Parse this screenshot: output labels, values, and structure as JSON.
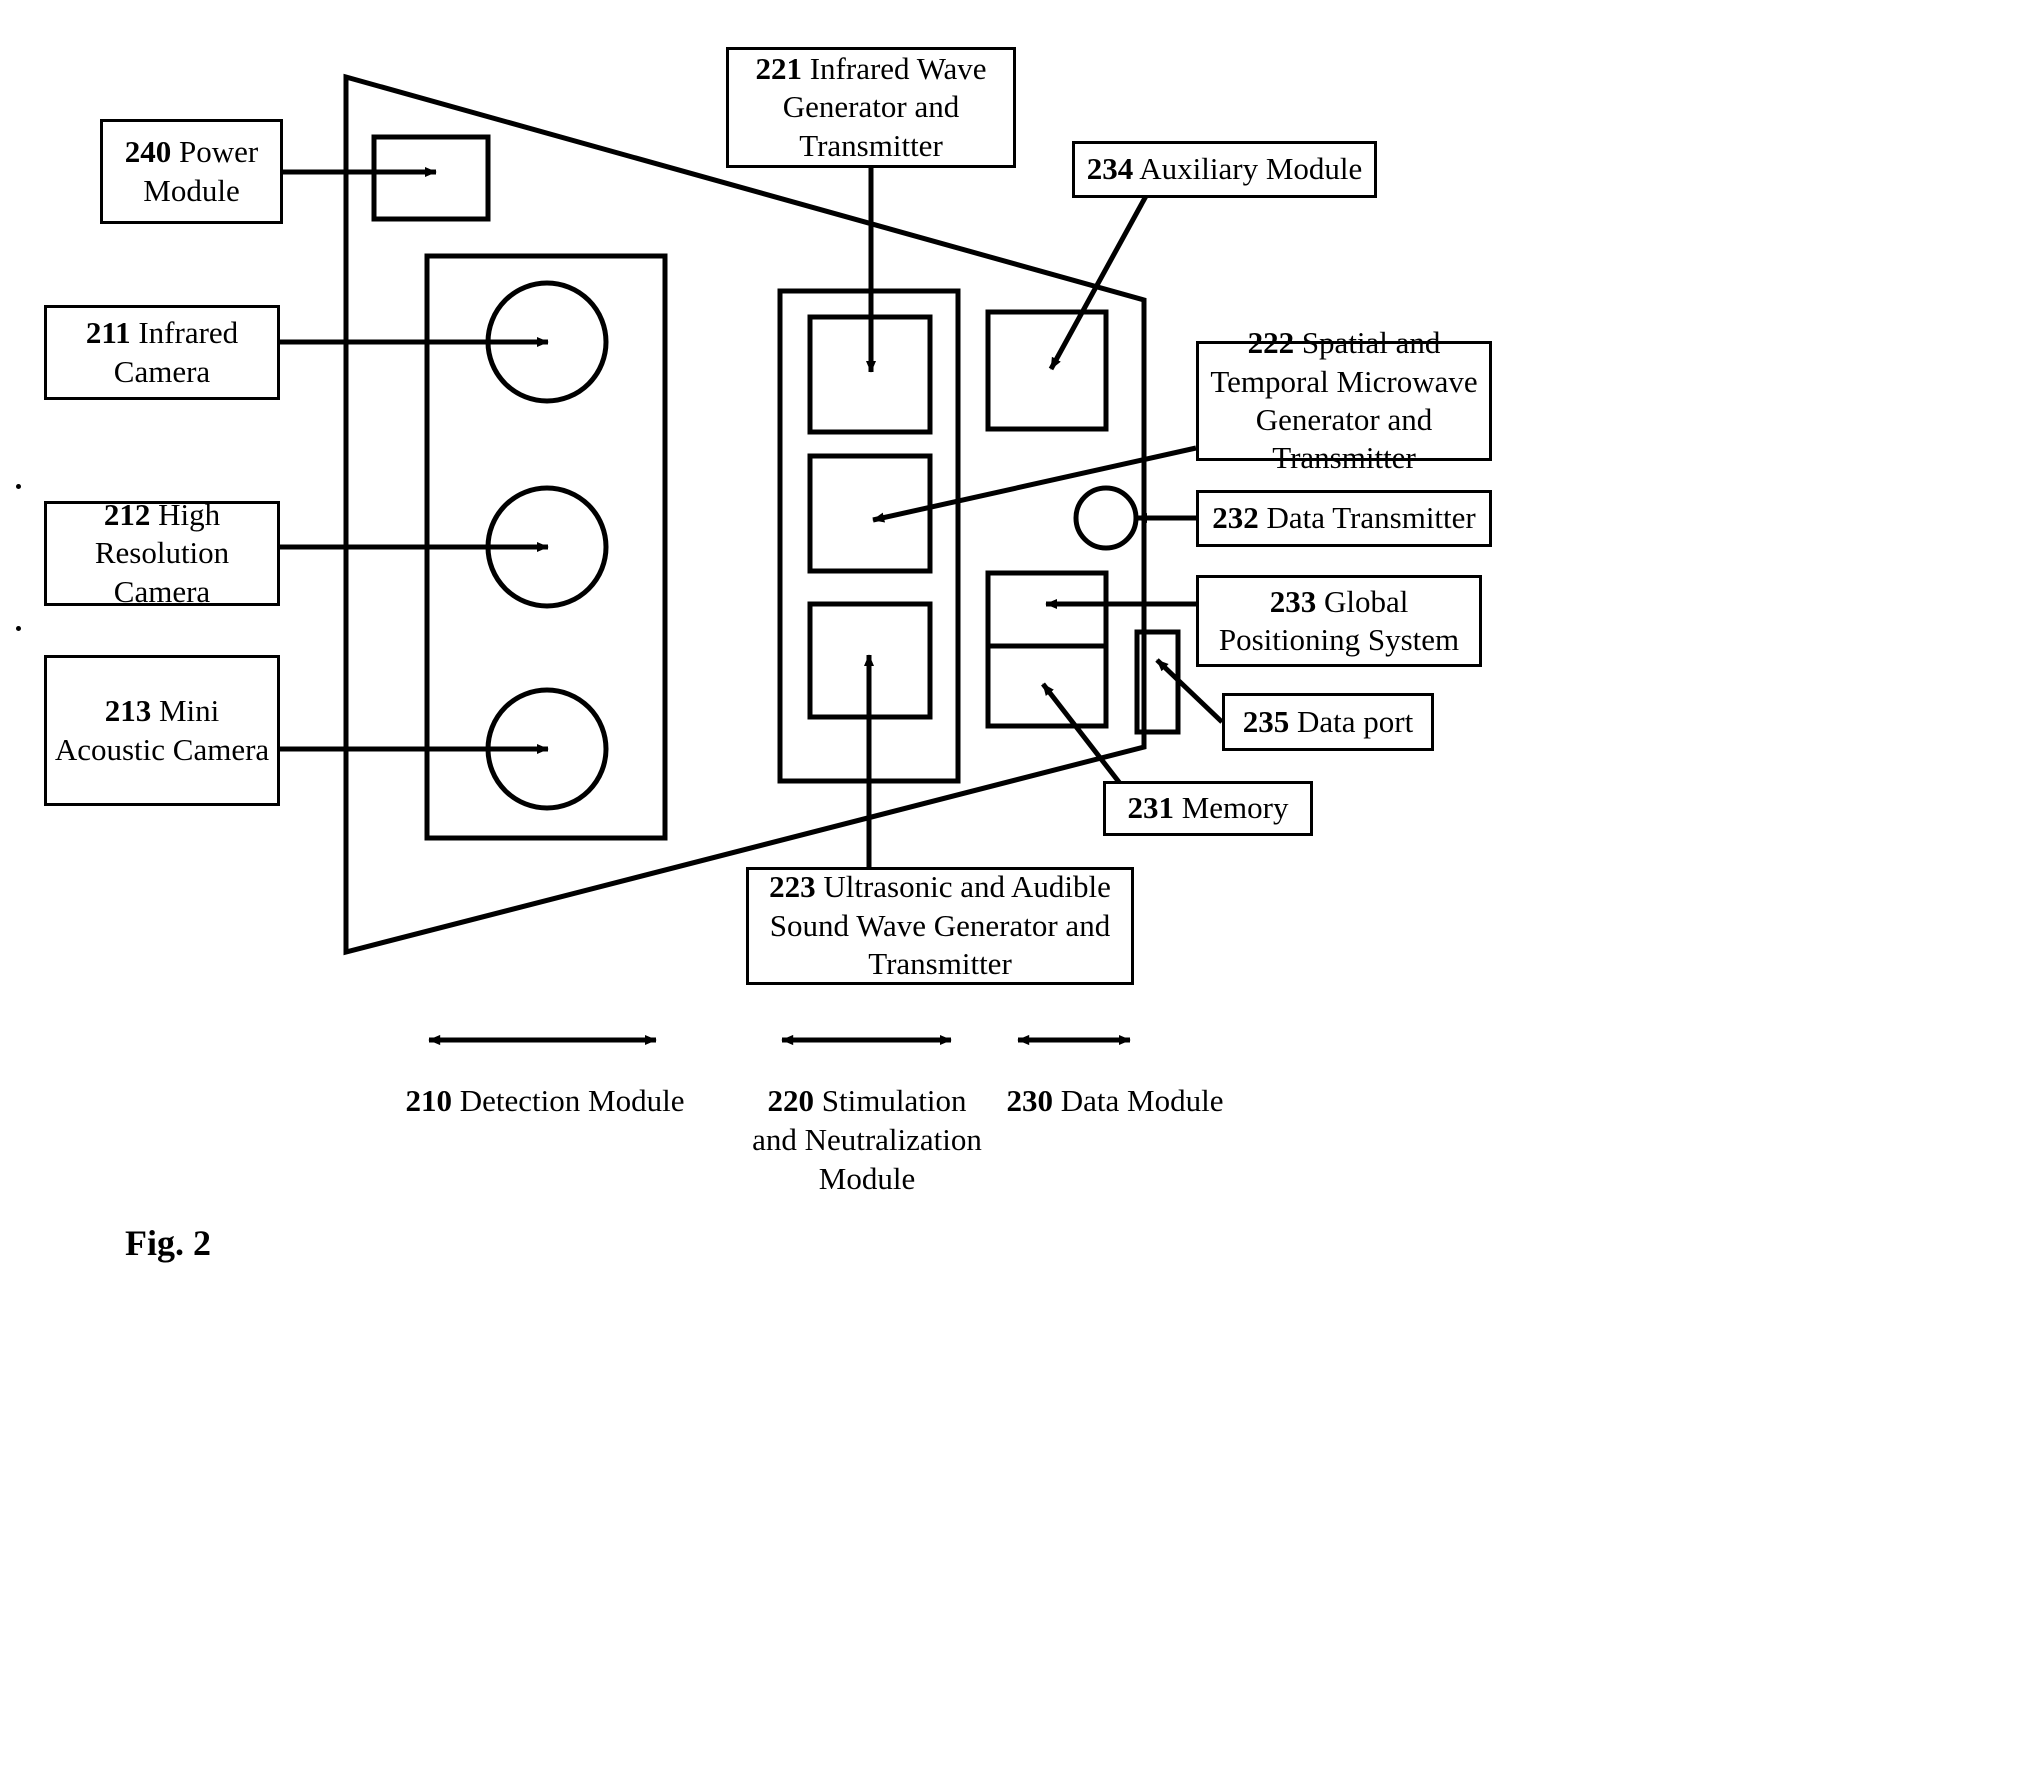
{
  "figure": {
    "caption": "Fig. 2"
  },
  "labels": {
    "power_module": {
      "num": "240",
      "text": "Power Module"
    },
    "infrared_camera": {
      "num": "211",
      "text": "Infrared Camera"
    },
    "high_resolution_camera": {
      "num": "212",
      "text": "High Resolution Camera"
    },
    "mini_acoustic_camera": {
      "num": "213",
      "text": "Mini Acoustic Camera"
    },
    "infrared_wave_generator": {
      "num": "221",
      "text": "Infrared Wave Generator and Transmitter"
    },
    "auxiliary_module": {
      "num": "234",
      "text": "Auxiliary Module"
    },
    "microwave_generator": {
      "num": "222",
      "text": "Spatial and Temporal Microwave Generator and Transmitter"
    },
    "data_transmitter": {
      "num": "232",
      "text": "Data Transmitter"
    },
    "gps": {
      "num": "233",
      "text": "Global Positioning System"
    },
    "data_port": {
      "num": "235",
      "text": "Data port"
    },
    "memory": {
      "num": "231",
      "text": "Memory"
    },
    "sound_wave_generator": {
      "num": "223",
      "text": "Ultrasonic and Audible Sound Wave Generator and Transmitter"
    }
  },
  "brackets": {
    "detection": {
      "num": "210",
      "text": "Detection Module"
    },
    "stimulation": {
      "num": "220",
      "text": "Stimulation and Neutralization Module"
    },
    "data": {
      "num": "230",
      "text": "Data Module"
    }
  },
  "colors": {
    "stroke": "#000000",
    "background": "#ffffff"
  }
}
